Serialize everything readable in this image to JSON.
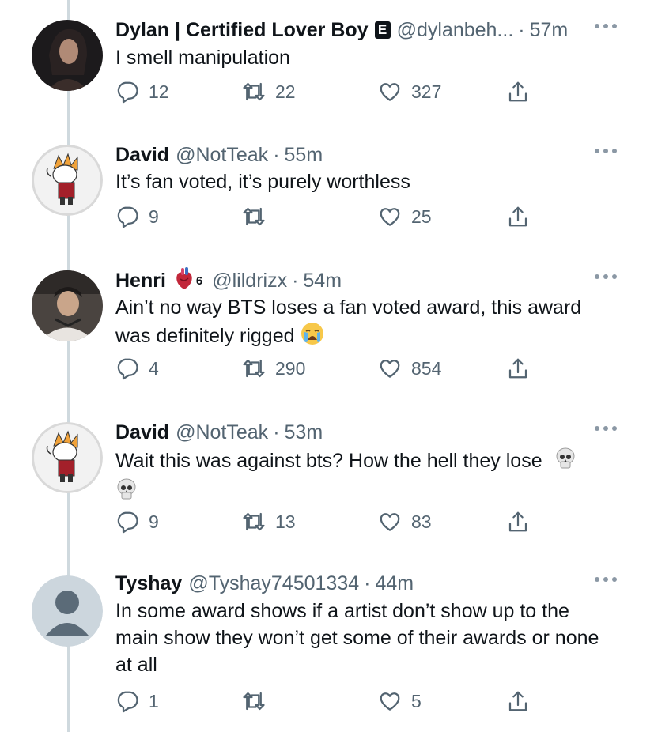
{
  "tweets": [
    {
      "name": "Dylan | Certified Lover Boy",
      "badge": "E",
      "handle": "@dylanbeh...",
      "time": "57m",
      "text": "I smell manipulation",
      "replies": "12",
      "retweets": "22",
      "likes": "327"
    },
    {
      "name": "David",
      "handle": "@NotTeak",
      "time": "55m",
      "text": "It’s fan voted, it’s purely worthless",
      "replies": "9",
      "retweets": "",
      "likes": "25"
    },
    {
      "name": "Henri",
      "superscript": "6",
      "handle": "@lildrizx",
      "time": "54m",
      "text_line1": "Ain’t no way BTS loses a fan voted award, this award",
      "text_line2": "was definitely rigged",
      "replies": "4",
      "retweets": "290",
      "likes": "854"
    },
    {
      "name": "David",
      "handle": "@NotTeak",
      "time": "53m",
      "text": "Wait this was against bts? How the hell they lose",
      "replies": "9",
      "retweets": "13",
      "likes": "83"
    },
    {
      "name": "Tyshay",
      "handle": "@Tyshay74501334",
      "time": "44m",
      "text_line1": "In some award shows if a artist don’t show up to the",
      "text_line2": "main show they won’t get some of their awards or none",
      "text_line3": "at all",
      "replies": "1",
      "retweets": "",
      "likes": "5"
    }
  ],
  "separator": "·",
  "colors": {
    "text": "#0f1419",
    "secondary": "#536471",
    "thread_line": "#cfd9de"
  },
  "icons": [
    "reply-icon",
    "retweet-icon",
    "like-icon",
    "share-icon",
    "more-icon",
    "skull-emoji",
    "crying-emoji",
    "anatomical-heart-emoji"
  ]
}
